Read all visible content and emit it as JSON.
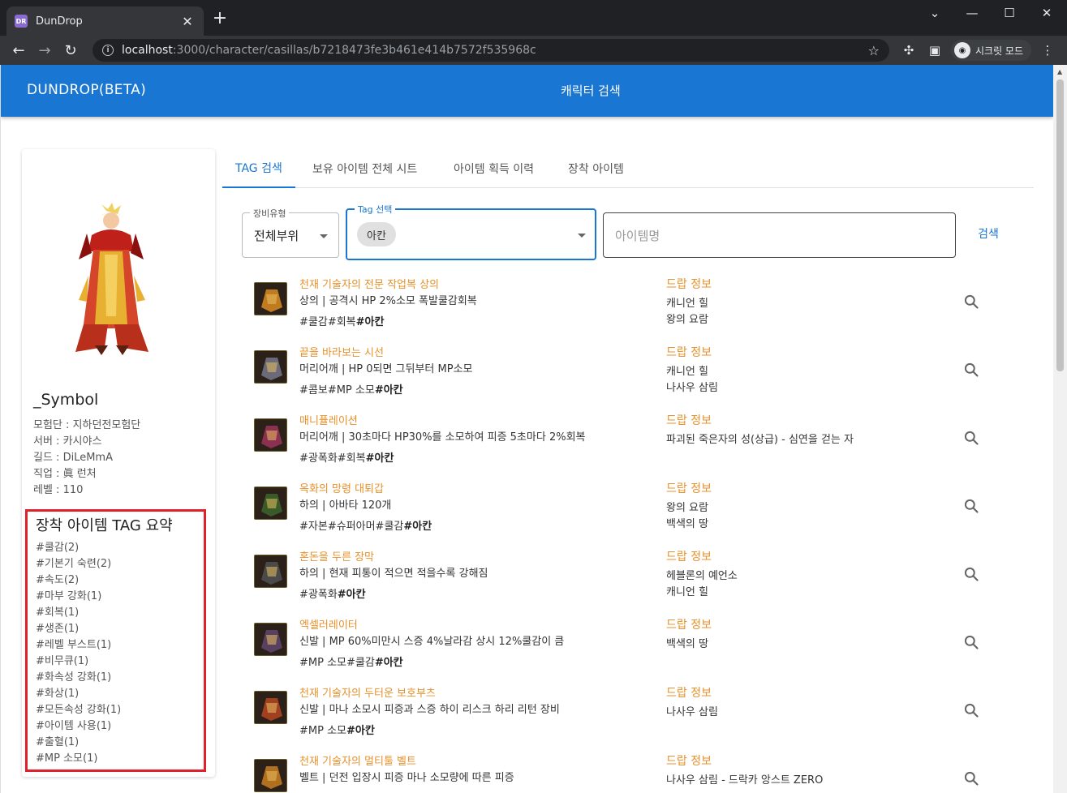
{
  "browser": {
    "tab_title": "DunDrop",
    "favicon_text": "DR",
    "url_host": "localhost",
    "url_path": ":3000/character/casillas/b7218473fe3b461e414b7572f535968c",
    "incognito_label": "시크릿 모드"
  },
  "app": {
    "brand": "DUNDROP(BETA)",
    "header_title": "캐릭터 검색"
  },
  "profile": {
    "name": "_Symbol",
    "info": [
      "모험단 : 지하던전모험단",
      "서버 : 카시야스",
      "길드 : DiLeMmA",
      "직업 : 眞 런처",
      "레벨 : 110"
    ],
    "tag_summary_title": "장착 아이템 TAG 요약",
    "tag_summary": [
      "#쿨감(2)",
      "#기본기 숙련(2)",
      "#속도(2)",
      "#마부 강화(1)",
      "#회복(1)",
      "#생존(1)",
      "#레벨 부스트(1)",
      "#비무큐(1)",
      "#화속성 강화(1)",
      "#화상(1)",
      "#모든속성 강화(1)",
      "#아이템 사용(1)",
      "#출혈(1)",
      "#MP 소모(1)"
    ]
  },
  "tabs": [
    "TAG 검색",
    "보유 아이템 전체 시트",
    "아이템 획득 이력",
    "장착 아이템"
  ],
  "filters": {
    "equip_type_label": "장비유형",
    "equip_type_value": "전체부위",
    "tag_label": "Tag 선택",
    "tag_chip": "아칸",
    "item_name_placeholder": "아이템명",
    "search_label": "검색"
  },
  "drop_header": "드랍 정보",
  "items": [
    {
      "name": "천재 기술자의 전문 작업복 상의",
      "desc": "상의 | 공격시 HP 2%소모 폭발쿨감회복",
      "tags": "#쿨감#회복",
      "tag_bold": "#아칸",
      "drops": [
        "캐니언 힐",
        "왕의 요람"
      ],
      "color": "#c07a20"
    },
    {
      "name": "끝을 바라보는 시선",
      "desc": "머리어깨 | HP 0되면 그뒤부터 MP소모",
      "tags": "#콤보#MP 소모",
      "tag_bold": "#아칸",
      "drops": [
        "캐니언 힐",
        "나사우 삼림"
      ],
      "color": "#6a6a7a"
    },
    {
      "name": "매니퓰레이션",
      "desc": "머리어깨 | 30초마다 HP30%를 소모하여 피증 5초마다 2%회복",
      "tags": "#광폭화#회복",
      "tag_bold": "#아칸",
      "drops": [
        "파괴된 죽은자의 성(상급) - 심연을 걷는 자"
      ],
      "color": "#8a3050"
    },
    {
      "name": "옥화의 망령 대퇴갑",
      "desc": "하의 | 아바타 120개",
      "tags": "#자본#슈퍼아머#쿨감",
      "tag_bold": "#아칸",
      "drops": [
        "왕의 요람",
        "백색의 땅"
      ],
      "color": "#3a5a2a"
    },
    {
      "name": "혼돈을 두른 장막",
      "desc": "하의 | 현재 피통이 적으면 적을수록 강해짐",
      "tags": "#광폭화",
      "tag_bold": "#아칸",
      "drops": [
        "헤블론의 예언소",
        "캐니언 힐"
      ],
      "color": "#4a4a4a"
    },
    {
      "name": "엑셀러레이터",
      "desc": "신발 | MP 60%미만시 스증 4%날라감 상시 12%쿨감이 큼",
      "tags": "#MP 소모#쿨감",
      "tag_bold": "#아칸",
      "drops": [
        "백색의 땅"
      ],
      "color": "#5a4060"
    },
    {
      "name": "천재 기술자의 두터운 보호부츠",
      "desc": "신발 | 마나 소모시 피증과 스증 하이 리스크 하리 리턴 장비",
      "tags": "#MP 소모",
      "tag_bold": "#아칸",
      "drops": [
        "나사우 삼림"
      ],
      "color": "#a04020"
    },
    {
      "name": "천재 기술자의 멀티툴 벨트",
      "desc": "벨트 | 던전 입장시 피증 마나 소모량에 따른 피증",
      "tags": "",
      "tag_bold": "",
      "drops": [
        "나사우 삼림 - 드락카 앙스트 ZERO"
      ],
      "color": "#b07020"
    }
  ]
}
